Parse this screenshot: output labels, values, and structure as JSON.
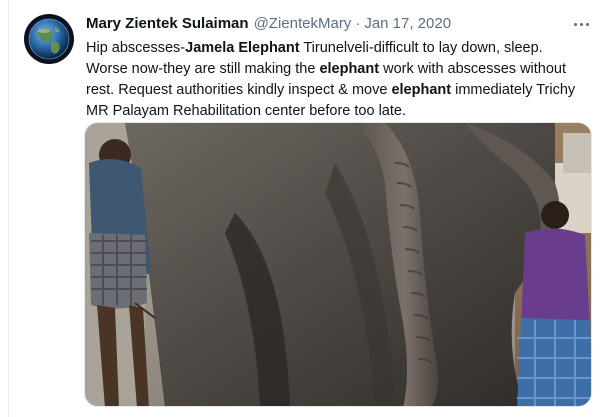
{
  "tweet": {
    "author": {
      "name": "Mary Zientek Sulaiman",
      "handle": "@ZientekMary",
      "separator": "·",
      "date": "Jan 17, 2020"
    },
    "text_lines": [
      [
        {
          "t": "Hip abscesses-",
          "b": false
        },
        {
          "t": "Jamela Elephant",
          "b": true
        },
        {
          "t": " Tirunelveli-difficult to lay down, sleep.",
          "b": false
        }
      ],
      [
        {
          "t": "Worse now-they are still making the ",
          "b": false
        },
        {
          "t": "elephant",
          "b": true
        },
        {
          "t": " work with abscesses without",
          "b": false
        }
      ],
      [
        {
          "t": "rest. Request authorities kindly inspect & move ",
          "b": false
        },
        {
          "t": "elephant",
          "b": true
        },
        {
          "t": " immediately Trichy",
          "b": false
        }
      ],
      [
        {
          "t": "MR Palayam Rehabilitation center before too late.",
          "b": false
        }
      ]
    ],
    "media": {
      "kind": "photo",
      "content": "elephant-with-two-handlers"
    },
    "icons": {
      "avatar": "earth-globe-avatar",
      "more": "more-options-icon"
    },
    "colors": {
      "secondary_text": "#5b7083",
      "primary_text": "#0f1419",
      "border": "#e1e8ed"
    }
  }
}
